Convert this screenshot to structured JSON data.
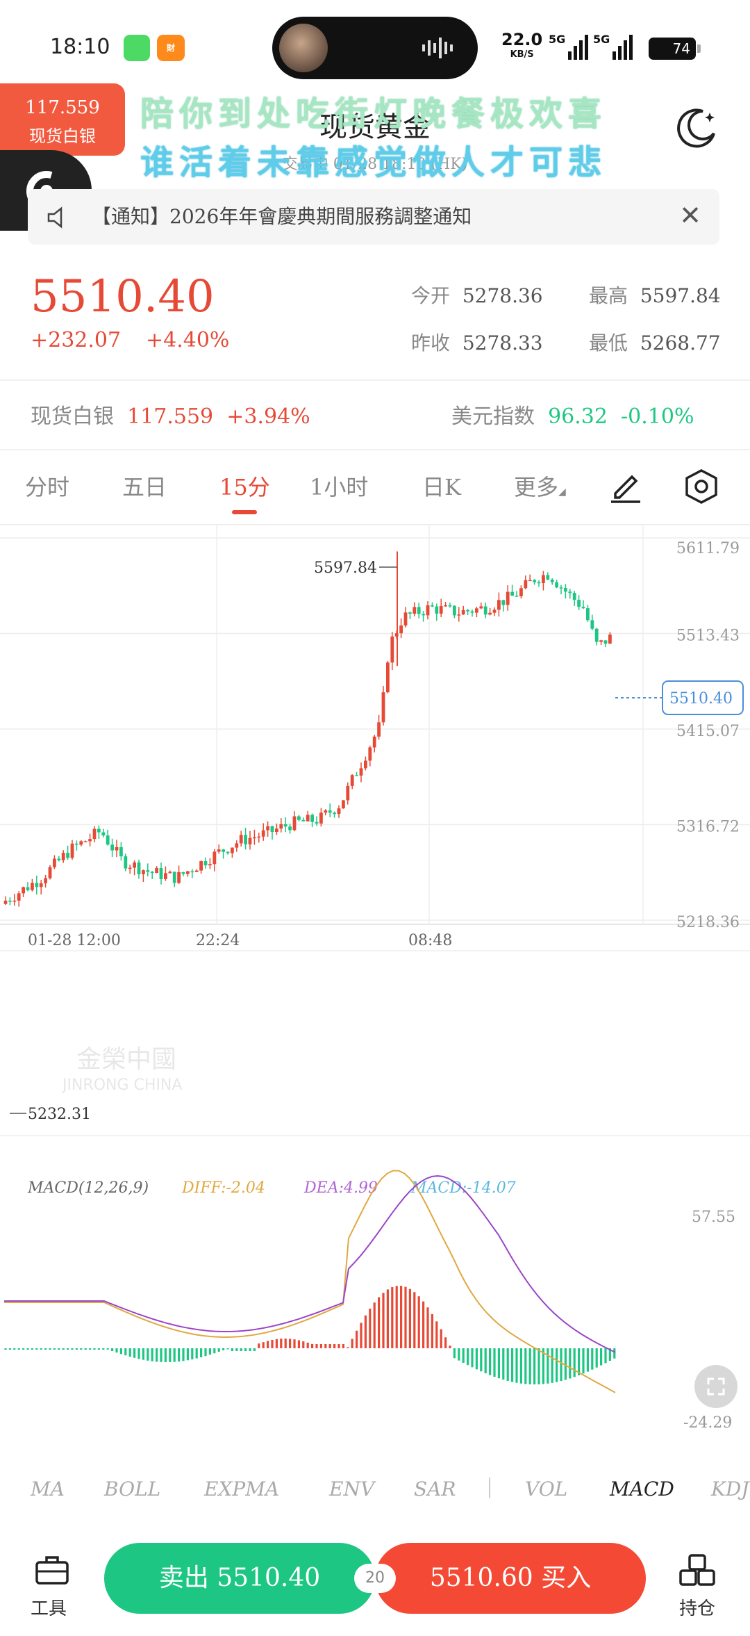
{
  "status_bar": {
    "time": "18:10",
    "app_badge": "財",
    "net_speed": "22.0",
    "net_unit": "KB/S",
    "sig1": "5G",
    "sig2": "5G",
    "battery": "74"
  },
  "floating": {
    "price": "117.559",
    "name": "现货白银"
  },
  "lyrics": {
    "line1": "陪你到处吃街灯晚餐极欢喜",
    "line2": "谁活着未靠感觉做人才可悲"
  },
  "header": {
    "title": "现货黄金",
    "subtitle": "交易中 01/28 18:10 (HK)"
  },
  "notice": {
    "text": "【通知】2026年年會慶典期間服務調整通知"
  },
  "quote": {
    "price": "5510.40",
    "change": "+232.07",
    "change_pct": "+4.40%",
    "open_label": "今开",
    "open": "5278.36",
    "high_label": "最高",
    "high": "5597.84",
    "prev_label": "昨收",
    "prev": "5278.33",
    "low_label": "最低",
    "low": "5268.77"
  },
  "ticker": {
    "silver_name": "现货白银",
    "silver_price": "117.559",
    "silver_pct": "+3.94%",
    "usd_name": "美元指数",
    "usd_price": "96.32",
    "usd_pct": "-0.10%"
  },
  "tabs": [
    "分时",
    "五日",
    "15分",
    "1小时",
    "日K",
    "更多"
  ],
  "active_tab": "15分",
  "chart_data": {
    "type": "candlestick",
    "y_ticks": [
      "5611.79",
      "5513.43",
      "5415.07",
      "5316.72",
      "5218.36"
    ],
    "ylim": [
      5218.36,
      5611.79
    ],
    "x_ticks": [
      "01-28 12:00",
      "22:24",
      "08:48"
    ],
    "current_price": "5510.40",
    "high_marker": "5597.84",
    "low_marker": "5232.31",
    "watermark": "金榮中國",
    "watermark_en": "JINRONG CHINA",
    "macd_header": "MACD(12,26,9)",
    "diff": "DIFF:-2.04",
    "dea": "DEA:4.99",
    "macd": "MACD:-14.07",
    "macd_top": "57.55",
    "macd_bottom": "-24.29",
    "up_color": "#e64a36",
    "down_color": "#1dc783"
  },
  "indicators": [
    "MA",
    "BOLL",
    "EXPMA",
    "ENV",
    "SAR",
    "VOL",
    "MACD",
    "KDJ"
  ],
  "active_indicator": "MACD",
  "bottom_bar": {
    "tools": "工具",
    "sell": "卖出 5510.40",
    "spread": "20",
    "buy": "5510.60 买入",
    "positions": "持仓"
  }
}
